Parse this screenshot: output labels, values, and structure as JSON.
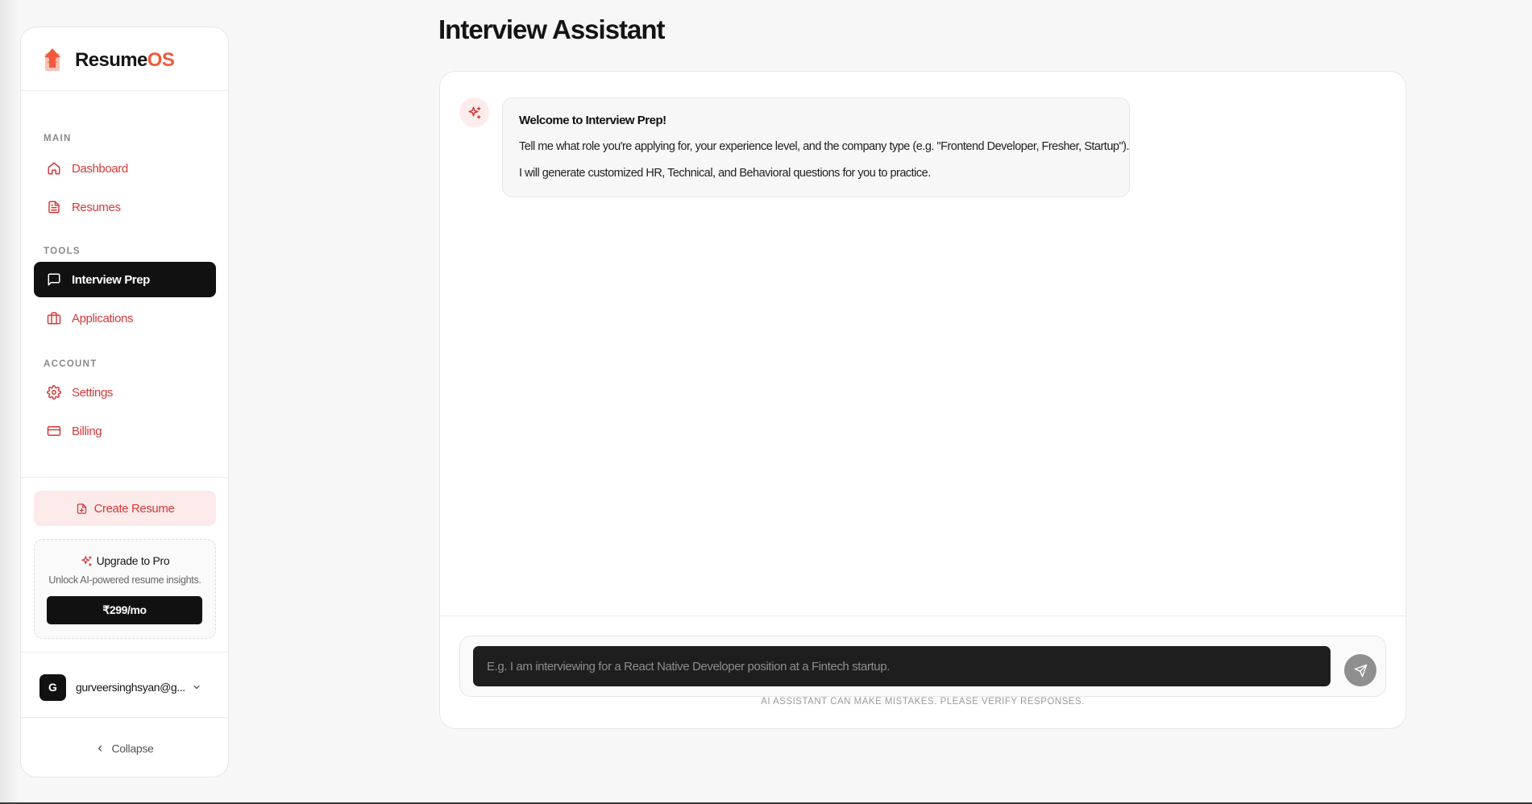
{
  "brand": {
    "name_main": "Resume",
    "name_accent": "OS",
    "accent_color": "#ef5a3c"
  },
  "sidebar": {
    "sections": {
      "main": "MAIN",
      "tools": "TOOLS",
      "account": "ACCOUNT"
    },
    "items": {
      "dashboard": {
        "label": "Dashboard",
        "icon": "home-icon"
      },
      "resumes": {
        "label": "Resumes",
        "icon": "file-icon"
      },
      "interview_prep": {
        "label": "Interview Prep",
        "icon": "message-square-icon",
        "active": true
      },
      "applications": {
        "label": "Applications",
        "icon": "briefcase-icon"
      },
      "settings": {
        "label": "Settings",
        "icon": "gear-icon"
      },
      "billing": {
        "label": "Billing",
        "icon": "credit-card-icon"
      }
    },
    "create_resume": {
      "label": "Create Resume",
      "icon": "file-plus-icon"
    },
    "upgrade": {
      "title": "Upgrade to Pro",
      "subtitle": "Unlock AI-powered resume insights.",
      "price_label": "₹299/mo",
      "icon": "sparkles-icon"
    },
    "user": {
      "initial": "G",
      "email": "gurveersinghsyan@g..."
    },
    "collapse_label": "Collapse"
  },
  "main": {
    "title": "Interview Assistant",
    "message": {
      "title": "Welcome to Interview Prep!",
      "line1": "Tell me what role you're applying for, your experience level, and the company type (e.g. \"Frontend Developer, Fresher, Startup\").",
      "line2": "I will generate customized HR, Technical, and Behavioral questions for you to practice."
    },
    "input": {
      "value": "",
      "placeholder": "E.g. I am interviewing for a React Native Developer position at a Fintech startup."
    },
    "disclaimer": "AI ASSISTANT CAN MAKE MISTAKES. PLEASE VERIFY RESPONSES."
  },
  "colors": {
    "accent_red": "#d53a3a",
    "active_bg": "#111111",
    "create_bg": "#fdeaea"
  }
}
